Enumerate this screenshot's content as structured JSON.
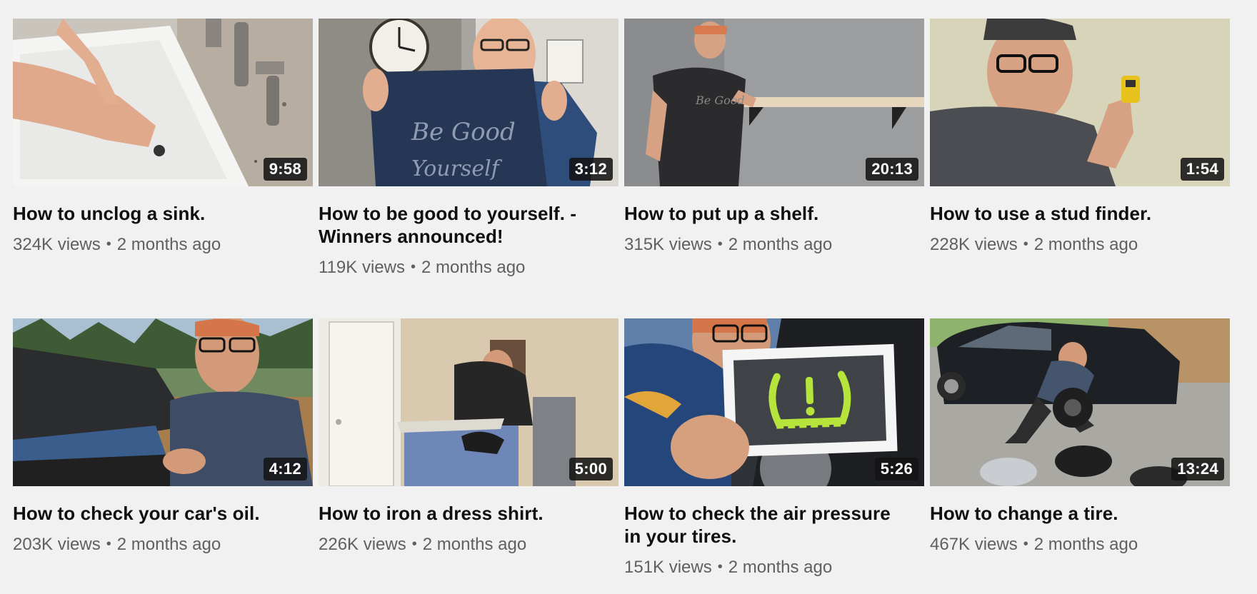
{
  "videos": [
    {
      "title": "How to unclog a sink.",
      "duration": "9:58",
      "views": "324K views",
      "age": "2 months ago",
      "thumbnail": "sink-thumbnail"
    },
    {
      "title": "How to be good to yourself. - Winners announced!",
      "duration": "3:12",
      "views": "119K views",
      "age": "2 months ago",
      "thumbnail": "tshirt-thumbnail",
      "shirt_text": "Be Good to Yourself"
    },
    {
      "title": "How to put up a shelf.",
      "duration": "20:13",
      "views": "315K views",
      "age": "2 months ago",
      "thumbnail": "shelf-thumbnail",
      "shirt_text": "Be Good to Yourself"
    },
    {
      "title": "How to use a stud finder.",
      "duration": "1:54",
      "views": "228K views",
      "age": "2 months ago",
      "thumbnail": "stud-finder-thumbnail"
    },
    {
      "title": "How to check your car's oil.",
      "duration": "4:12",
      "views": "203K views",
      "age": "2 months ago",
      "thumbnail": "car-oil-thumbnail"
    },
    {
      "title": "How to iron a dress shirt.",
      "duration": "5:00",
      "views": "226K views",
      "age": "2 months ago",
      "thumbnail": "iron-thumbnail"
    },
    {
      "title": "How to check the air pressure in your tires.",
      "duration": "5:26",
      "views": "151K views",
      "age": "2 months ago",
      "thumbnail": "tire-pressure-thumbnail"
    },
    {
      "title": "How to change a tire.",
      "duration": "13:24",
      "views": "467K views",
      "age": "2 months ago",
      "thumbnail": "change-tire-thumbnail"
    }
  ],
  "separator": "•",
  "colors": {
    "background": "#f1f1f1",
    "title": "#0f0f0f",
    "meta": "#606060",
    "duration_badge": "#141414",
    "warning_light": "#b6e43a"
  }
}
